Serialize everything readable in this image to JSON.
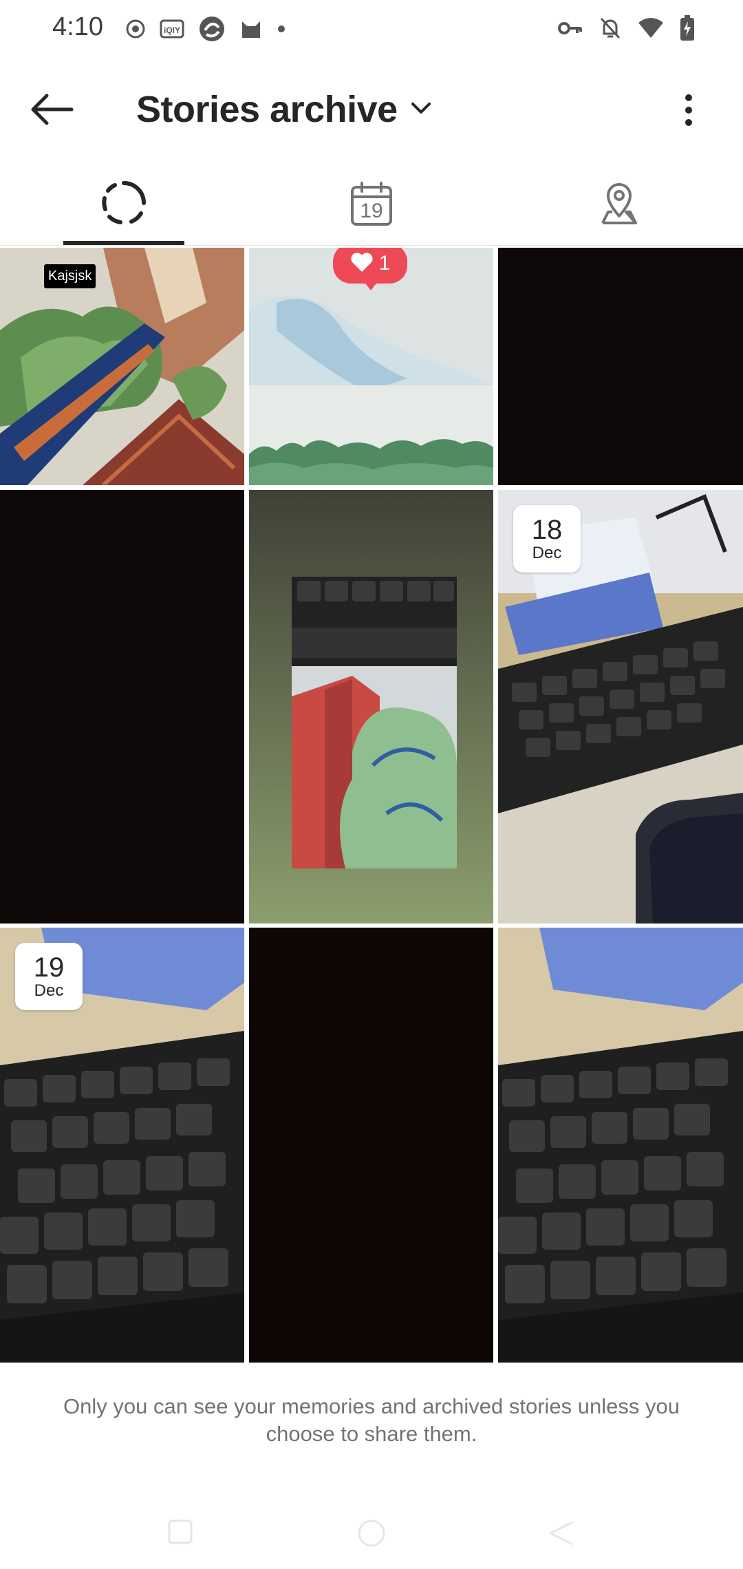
{
  "status_bar": {
    "time": "4:10",
    "left_icons": [
      "record-icon",
      "iqiyi-icon",
      "app-icon",
      "cat-icon",
      "dot-icon"
    ],
    "right_icons": [
      "key-icon",
      "bell-off-icon",
      "wifi-icon",
      "battery-charging-icon"
    ]
  },
  "header": {
    "title": "Stories archive",
    "back_icon": "arrow-left-icon",
    "dropdown_icon": "chevron-down-icon",
    "more_icon": "more-vertical-icon"
  },
  "tabs": [
    {
      "name": "stories",
      "icon": "circle-dashed-icon",
      "active": true
    },
    {
      "name": "calendar",
      "icon": "calendar-icon",
      "calendar_number": "19",
      "active": false
    },
    {
      "name": "map",
      "icon": "map-pin-icon",
      "active": false
    }
  ],
  "grid": {
    "tiles": [
      {
        "kind": "illustration",
        "label": "Kajsjsk"
      },
      {
        "kind": "illustration",
        "likes": "1"
      },
      {
        "kind": "dark"
      },
      {
        "kind": "dark"
      },
      {
        "kind": "keyboard-photo"
      },
      {
        "kind": "keyboard-photo",
        "date_day": "18",
        "date_month": "Dec"
      },
      {
        "kind": "keyboard-photo",
        "date_day": "19",
        "date_month": "Dec"
      },
      {
        "kind": "dark"
      },
      {
        "kind": "keyboard-photo"
      }
    ]
  },
  "footer": {
    "note": "Only you can see your memories and archived stories unless you choose to share them."
  },
  "colors": {
    "accent_like": "#ed4956",
    "text_primary": "#262626",
    "text_secondary": "#737373"
  }
}
